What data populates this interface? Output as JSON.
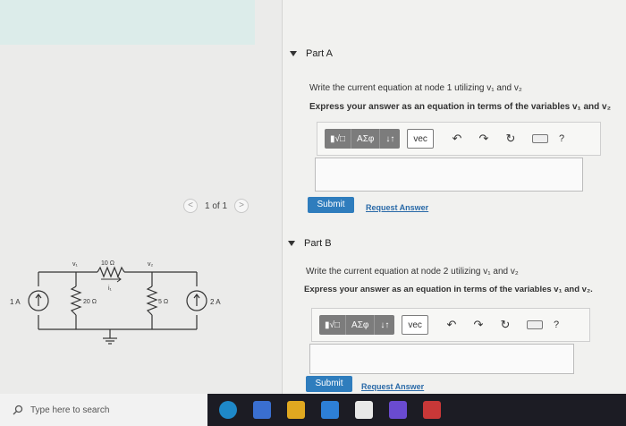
{
  "pager": {
    "prev": "<",
    "label": "1 of 1",
    "next": ">"
  },
  "circuit": {
    "source_left": "1 A",
    "source_right": "2 A",
    "r_top": "10 Ω",
    "r_left": "20 Ω",
    "r_mid": "5 Ω",
    "node1": "v₁",
    "node2": "v₂",
    "current": "i₁"
  },
  "part_a": {
    "title": "Part A",
    "question": "Write the current equation at node 1 utilizing v₁ and v₂",
    "instruction": "Express your answer as an equation in terms of the variables v₁ and v₂",
    "submit": "Submit",
    "request": "Request Answer"
  },
  "part_b": {
    "title": "Part B",
    "question": "Write the current equation at node 2 utilizing v₁ and v₂",
    "instruction": "Express your answer as an equation in terms of the variables v₁ and v₂.",
    "submit": "Submit",
    "request": "Request Answer"
  },
  "toolbar": {
    "template_btn": "▮√□",
    "symbols_btn": "ΑΣφ",
    "arrows_btn": "↓↑",
    "vec_btn": "vec",
    "undo_icon": "↶",
    "redo_icon": "↷",
    "reset_icon": "↻",
    "help": "?"
  },
  "taskbar": {
    "search_placeholder": "Type here to search"
  },
  "colors": {
    "accent": "#2f7dbd",
    "link": "#2a6aa8",
    "taskbar": "#1c1c24"
  }
}
